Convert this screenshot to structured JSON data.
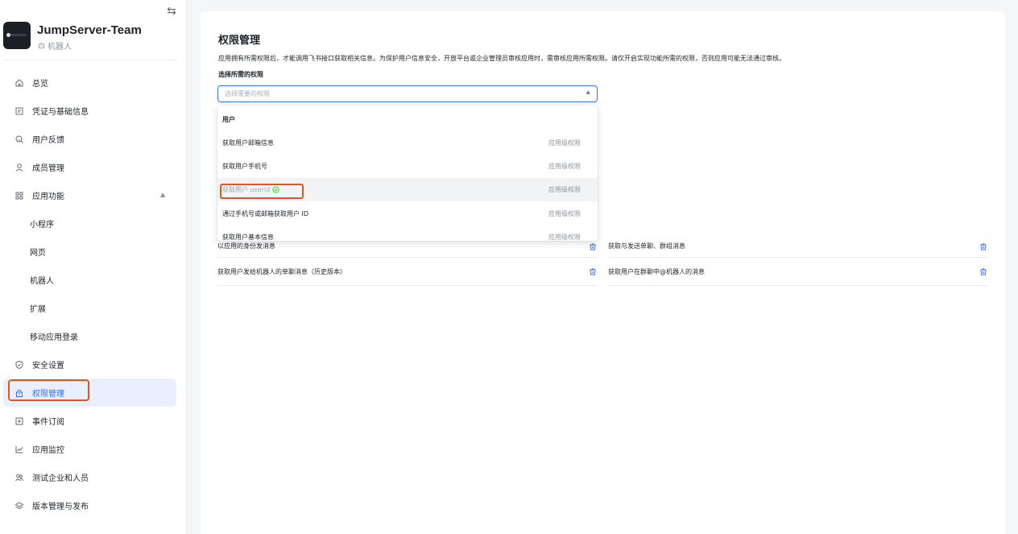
{
  "sidebar": {
    "app_name": "JumpServer-Team",
    "app_type": "机器人",
    "items": [
      {
        "label": "总览",
        "icon": "home-icon"
      },
      {
        "label": "凭证与基础信息",
        "icon": "credential-icon"
      },
      {
        "label": "用户反馈",
        "icon": "feedback-icon"
      },
      {
        "label": "成员管理",
        "icon": "user-icon"
      },
      {
        "label": "应用功能",
        "icon": "grid-icon"
      },
      {
        "label": "小程序"
      },
      {
        "label": "网页"
      },
      {
        "label": "机器人"
      },
      {
        "label": "扩展"
      },
      {
        "label": "移动应用登录"
      },
      {
        "label": "安全设置",
        "icon": "shield-icon"
      },
      {
        "label": "权限管理",
        "icon": "lock-icon"
      },
      {
        "label": "事件订阅",
        "icon": "event-icon"
      },
      {
        "label": "应用监控",
        "icon": "chart-icon"
      },
      {
        "label": "测试企业和人员",
        "icon": "people-icon"
      },
      {
        "label": "版本管理与发布",
        "icon": "layers-icon"
      }
    ]
  },
  "main": {
    "title": "权限管理",
    "description": "应用拥有所需权限后，才能调用飞书接口获取相关信息。为保护用户信息安全，开放平台或企业管理员审核应用时，需审核应用所需权限。请仅开启实现功能所需的权限，否则应用可能无法通过审核。",
    "select_label": "选择所需的权限",
    "select_placeholder": "选择需要的权限",
    "dropdown": {
      "group": "用户",
      "options": [
        {
          "label": "获取用户邮箱信息",
          "level": "应用级权限"
        },
        {
          "label": "获取用户手机号",
          "level": "应用级权限"
        },
        {
          "label": "获取用户 userid",
          "level": "应用级权限",
          "selected": true
        },
        {
          "label": "通过手机号或邮箱获取用户 ID",
          "level": "应用级权限"
        },
        {
          "label": "获取用户基本信息",
          "level": "应用级权限"
        }
      ]
    },
    "permissions": [
      "以应用的身份发消息",
      "获取与发送单聊、群组消息",
      "获取用户发给机器人的单聊消息（历史版本）",
      "获取用户在群聊中@机器人的消息"
    ]
  },
  "colors": {
    "accent": "#3370ff",
    "highlight": "#e6541c",
    "success": "#34c724"
  }
}
